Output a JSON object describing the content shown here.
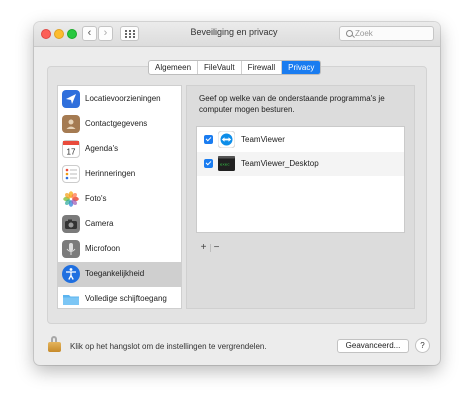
{
  "window": {
    "title": "Beveiliging en privacy",
    "search_placeholder": "Zoek",
    "back": "‹",
    "forward": "›"
  },
  "tabs": [
    {
      "label": "Algemeen",
      "active": false
    },
    {
      "label": "FileVault",
      "active": false
    },
    {
      "label": "Firewall",
      "active": false
    },
    {
      "label": "Privacy",
      "active": true
    }
  ],
  "sidebar": {
    "items": [
      {
        "label": "Locatievoorzieningen",
        "icon": "location-arrow-icon"
      },
      {
        "label": "Contactgegevens",
        "icon": "contacts-book-icon"
      },
      {
        "label": "Agenda's",
        "icon": "calendar-icon",
        "icon_text": "17"
      },
      {
        "label": "Herinneringen",
        "icon": "reminders-list-icon"
      },
      {
        "label": "Foto's",
        "icon": "photos-flower-icon"
      },
      {
        "label": "Camera",
        "icon": "camera-icon"
      },
      {
        "label": "Microfoon",
        "icon": "microphone-icon"
      },
      {
        "label": "Toegankelijkheid",
        "icon": "accessibility-icon",
        "selected": true
      },
      {
        "label": "Volledige schijftoegang",
        "icon": "folder-icon"
      }
    ]
  },
  "main": {
    "description": "Geef op welke van de onderstaande programma's je computer mogen besturen.",
    "apps": [
      {
        "name": "TeamViewer",
        "checked": true,
        "icon": "teamviewer-icon"
      },
      {
        "name": "TeamViewer_Desktop",
        "checked": true,
        "icon": "terminal-exec-icon"
      }
    ],
    "add": "+",
    "remove": "−"
  },
  "footer": {
    "lock_text": "Klik op het hangslot om de instellingen te vergrendelen.",
    "advanced_label": "Geavanceerd...",
    "help_label": "?"
  },
  "colors": {
    "accent": "#1a7cf0",
    "selection": "#cfcfcf",
    "window_bg": "#ececec"
  }
}
